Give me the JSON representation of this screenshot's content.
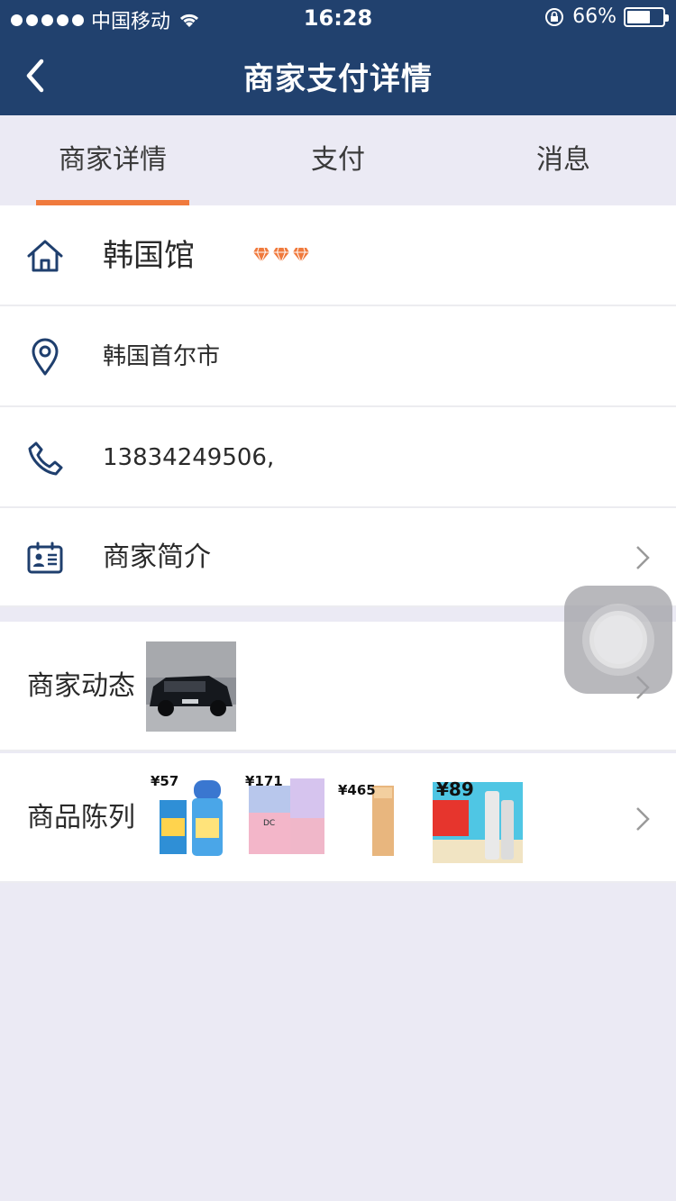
{
  "status_bar": {
    "carrier": "中国移动",
    "time": "16:28",
    "battery": "66%",
    "battery_level": 0.66
  },
  "nav": {
    "title": "商家支付详情",
    "back_icon": "chevron-left-icon"
  },
  "tabs": [
    {
      "label": "商家详情",
      "active": true
    },
    {
      "label": "支付",
      "active": false
    },
    {
      "label": "消息",
      "active": false
    }
  ],
  "colors": {
    "nav_bg": "#21416e",
    "accent": "#f07a3d",
    "page_bg": "#ebeaf4",
    "icon": "#1f3f6e"
  },
  "merchant": {
    "name": "韩国馆",
    "rating_gems": 3,
    "address": "韩国首尔市",
    "phone": "13834249506,",
    "intro_label": "商家简介"
  },
  "sections": {
    "news_label": "商家动态",
    "products_label": "商品陈列"
  },
  "products": [
    {
      "price": "¥57"
    },
    {
      "price": "¥171"
    },
    {
      "price": "¥465"
    },
    {
      "price": "¥89"
    }
  ]
}
